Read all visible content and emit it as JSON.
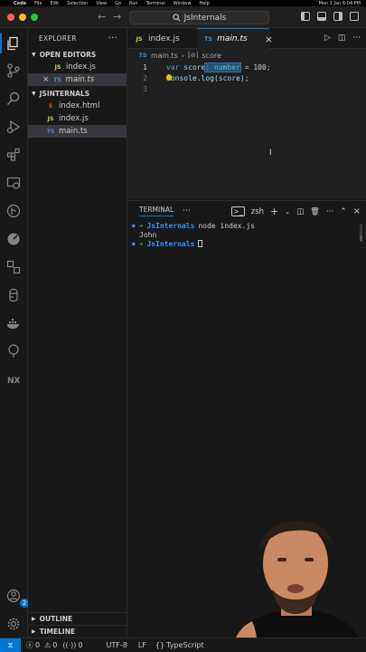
{
  "menubar": {
    "app": "Code",
    "items": [
      "File",
      "Edit",
      "Selection",
      "View",
      "Go",
      "Run",
      "Terminal",
      "Window",
      "Help"
    ],
    "clock": "Mon 1 Jan 6:04 PM"
  },
  "titlebar": {
    "search_text": "JsInternals"
  },
  "activity": {
    "accounts_badge": "2"
  },
  "sidebar": {
    "title": "EXPLORER",
    "open_editors_label": "OPEN EDITORS",
    "open_editors": [
      {
        "name": "index.js",
        "lang": "JS"
      },
      {
        "name": "main.ts",
        "lang": "TS"
      }
    ],
    "project_label": "JSINTERNALS",
    "files": [
      {
        "name": "index.html",
        "lang": "HTML"
      },
      {
        "name": "index.js",
        "lang": "JS"
      },
      {
        "name": "main.ts",
        "lang": "TS"
      }
    ],
    "outline_label": "OUTLINE",
    "timeline_label": "TIMELINE"
  },
  "editor": {
    "tabs": [
      {
        "name": "index.js",
        "lang": "JS"
      },
      {
        "name": "main.ts",
        "lang": "TS"
      }
    ],
    "breadcrumb_file": "main.ts",
    "breadcrumb_symbol": "score",
    "lines": [
      {
        "num": "1",
        "kw": "var",
        "var": "score",
        "type_sel": ": number",
        "rest": " = 100;"
      },
      {
        "num": "2",
        "text": "console.log(score);"
      },
      {
        "num": "3",
        "text": ""
      }
    ]
  },
  "terminal": {
    "tab_label": "TERMINAL",
    "shell": "zsh",
    "lines": [
      {
        "dir": "JsInternals",
        "cmd": "node index.js"
      },
      {
        "output": "John"
      },
      {
        "dir": "JsInternals",
        "cmd": ""
      }
    ]
  },
  "statusbar": {
    "errors": "0",
    "warnings": "0",
    "ports": "0",
    "encoding": "UTF-8",
    "eol": "LF",
    "language": "TypeScript"
  },
  "colors": {
    "accent": "#0078d4",
    "background": "#181818",
    "editor_bg": "#1f1f1f"
  }
}
